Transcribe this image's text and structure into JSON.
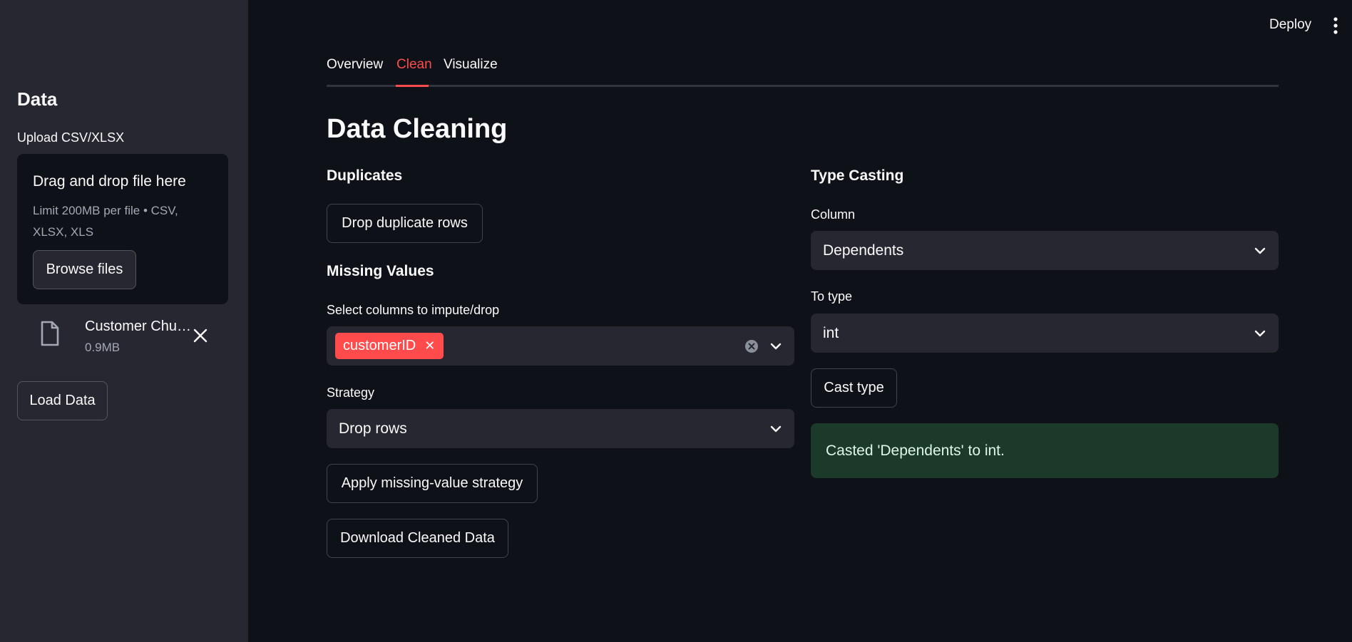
{
  "sidebar": {
    "heading": "Data",
    "upload_label": "Upload CSV/XLSX",
    "dropzone": {
      "title": "Drag and drop file here",
      "limit": "Limit 200MB per file • CSV, XLSX, XLS",
      "browse_label": "Browse files"
    },
    "file": {
      "name": "Customer Churn.csv",
      "size": "0.9MB",
      "icon": "file-icon"
    },
    "load_label": "Load Data"
  },
  "header": {
    "deploy_label": "Deploy",
    "menu_icon": "kebab-menu-icon"
  },
  "tabs": [
    {
      "label": "Overview",
      "active": false
    },
    {
      "label": "Clean",
      "active": true
    },
    {
      "label": "Visualize",
      "active": false
    }
  ],
  "main": {
    "title": "Data Cleaning",
    "duplicates": {
      "heading": "Duplicates",
      "button": "Drop duplicate rows"
    },
    "missing": {
      "heading": "Missing Values",
      "select_label": "Select columns to impute/drop",
      "selected_tags": [
        "customerID"
      ],
      "strategy_label": "Strategy",
      "strategy_value": "Drop rows",
      "apply_button": "Apply missing-value strategy",
      "download_button": "Download Cleaned Data"
    },
    "typecast": {
      "heading": "Type Casting",
      "column_label": "Column",
      "column_value": "Dependents",
      "totype_label": "To type",
      "totype_value": "int",
      "cast_button": "Cast type",
      "success_message": "Casted 'Dependents' to int."
    }
  },
  "colors": {
    "accent": "#ff4b4b",
    "background": "#0e1117",
    "sidebar": "#262730",
    "success_bg": "#1b3a2a"
  }
}
